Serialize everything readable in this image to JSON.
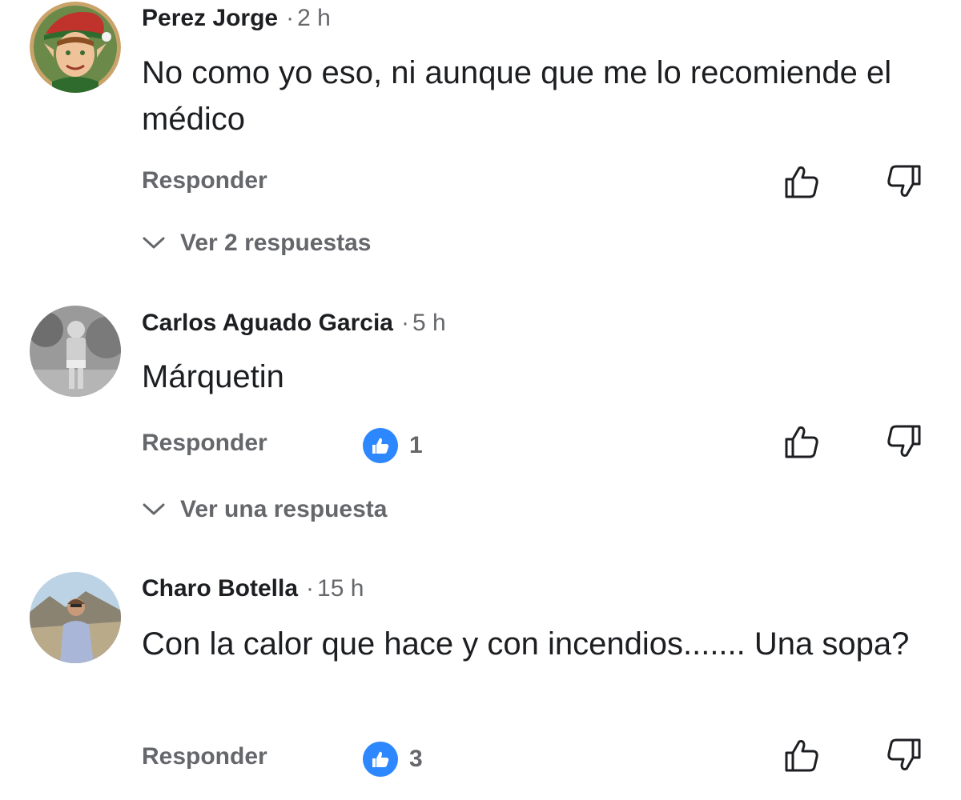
{
  "comments": [
    {
      "author": "Perez Jorge",
      "separator": "·",
      "time": "2 h",
      "text": "No como yo eso, ni aunque que me lo recomiende el médico",
      "reply_label": "Responder",
      "view_replies_label": "Ver 2 respuestas",
      "avatar_icon": "elf-avatar"
    },
    {
      "author": "Carlos Aguado Garcia",
      "separator": "·",
      "time": "5 h",
      "text": "Márquetin",
      "reply_label": "Responder",
      "like_count": "1",
      "view_replies_label": "Ver una respuesta",
      "avatar_icon": "bw-photo-avatar"
    },
    {
      "author": "Charo Botella",
      "separator": "·",
      "time": "15 h",
      "text": "Con la calor que hace y con incendios....... Una sopa?",
      "reply_label": "Responder",
      "like_count": "3",
      "avatar_icon": "mountain-photo-avatar"
    }
  ],
  "icons": {
    "thumbs_up": "thumbs-up-outline-icon",
    "thumbs_down": "thumbs-down-outline-icon",
    "like_badge": "like-badge-icon",
    "chevron": "chevron-down-icon"
  },
  "colors": {
    "text_primary": "#1c1e21",
    "text_secondary": "#65676b",
    "like_blue": "#2d88ff"
  }
}
